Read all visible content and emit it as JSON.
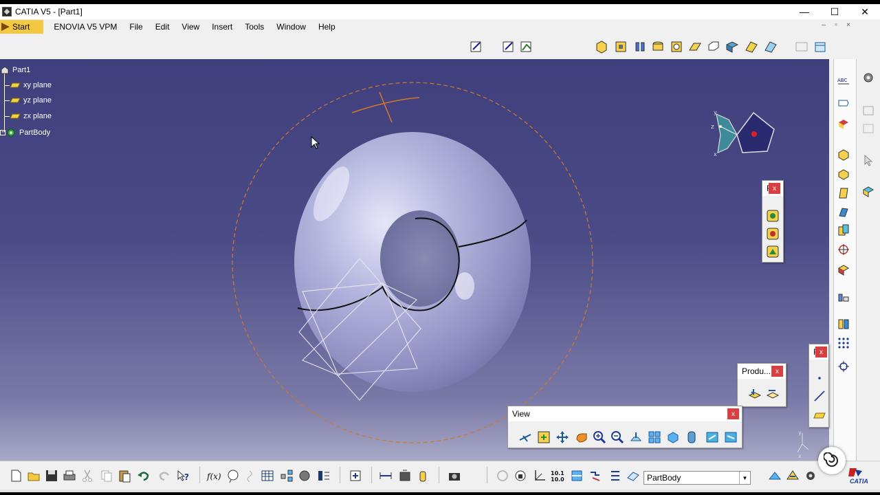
{
  "window": {
    "title": "CATIA V5 - [Part1]",
    "controls": [
      "—",
      "☐",
      "✕"
    ]
  },
  "menu": {
    "start": "Start",
    "items": [
      "ENOVIA V5 VPM",
      "File",
      "Edit",
      "View",
      "Insert",
      "Tools",
      "Window",
      "Help"
    ]
  },
  "tree": {
    "root": "Part1",
    "items": [
      "xy plane",
      "yz plane",
      "zx plane",
      "PartBody"
    ]
  },
  "compass": {
    "labels": [
      "y",
      "z",
      "x"
    ]
  },
  "axis_triad": {
    "labels": [
      "y",
      "x"
    ]
  },
  "palettes": {
    "sketch_tools": {
      "title": "F",
      "close": "x"
    },
    "product": {
      "title": "Produ...",
      "close": "x"
    },
    "reference": {
      "title": "F",
      "close": "x"
    },
    "view": {
      "title": "View",
      "close": "x"
    }
  },
  "bottom": {
    "current_body": "PartBody",
    "brand": "CATIA"
  },
  "colors": {
    "viewport_top": "#3f3f7d",
    "torus": "#a9aad6",
    "circle": "#d2782a",
    "start_button": "#f5c842",
    "close_button": "#d64040"
  }
}
